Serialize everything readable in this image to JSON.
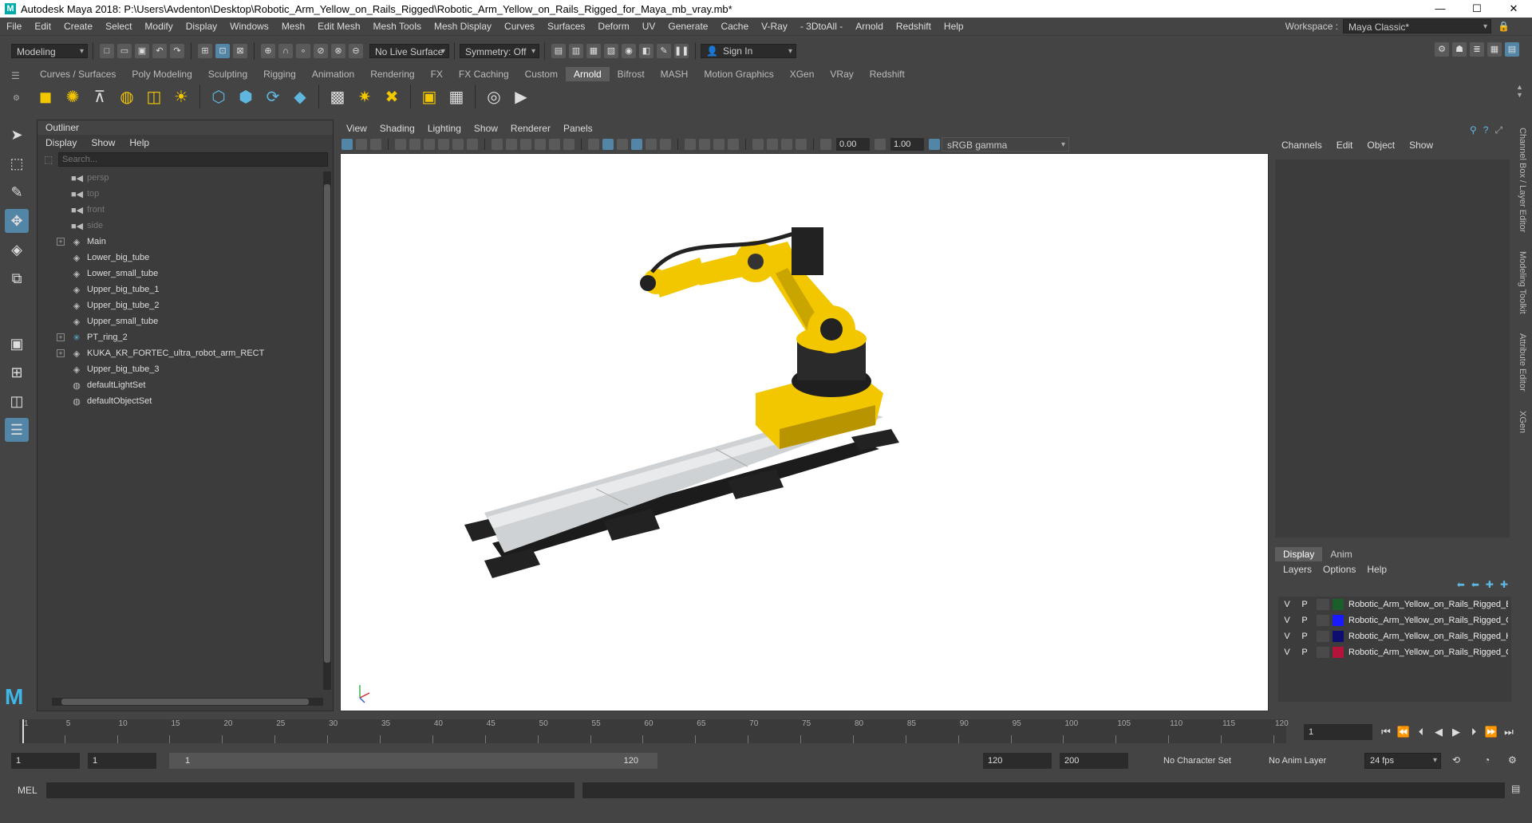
{
  "app": {
    "title": "Autodesk Maya 2018: P:\\Users\\Avdenton\\Desktop\\Robotic_Arm_Yellow_on_Rails_Rigged\\Robotic_Arm_Yellow_on_Rails_Rigged_for_Maya_mb_vray.mb*",
    "logo_letter": "M"
  },
  "window_controls": {
    "minimize": "—",
    "maximize": "☐",
    "close": "✕"
  },
  "menu": [
    "File",
    "Edit",
    "Create",
    "Select",
    "Modify",
    "Display",
    "Windows",
    "Mesh",
    "Edit Mesh",
    "Mesh Tools",
    "Mesh Display",
    "Curves",
    "Surfaces",
    "Deform",
    "UV",
    "Generate",
    "Cache",
    "V-Ray",
    "- 3DtoAll -",
    "Arnold",
    "Redshift",
    "Help"
  ],
  "workspace": {
    "label": "Workspace :",
    "value": "Maya Classic*"
  },
  "status_line": {
    "mode": "Modeling",
    "live_surface": "No Live Surface",
    "symmetry": "Symmetry: Off",
    "sign_in": "Sign In"
  },
  "shelf_tabs": [
    "Curves / Surfaces",
    "Poly Modeling",
    "Sculpting",
    "Rigging",
    "Animation",
    "Rendering",
    "FX",
    "FX Caching",
    "Custom",
    "Arnold",
    "Bifrost",
    "MASH",
    "Motion Graphics",
    "XGen",
    "VRay",
    "Redshift"
  ],
  "shelf_active": "Arnold",
  "outliner": {
    "title": "Outliner",
    "menus": [
      "Display",
      "Show",
      "Help"
    ],
    "search_placeholder": "Search...",
    "items": [
      {
        "label": "persp",
        "icon": "camera-icon",
        "dim": true,
        "expand": false
      },
      {
        "label": "top",
        "icon": "camera-icon",
        "dim": true,
        "expand": false
      },
      {
        "label": "front",
        "icon": "camera-icon",
        "dim": true,
        "expand": false
      },
      {
        "label": "side",
        "icon": "camera-icon",
        "dim": true,
        "expand": false
      },
      {
        "label": "Main",
        "icon": "transform-icon",
        "dim": false,
        "expand": true
      },
      {
        "label": "Lower_big_tube",
        "icon": "transform-icon",
        "dim": false,
        "expand": false
      },
      {
        "label": "Lower_small_tube",
        "icon": "transform-icon",
        "dim": false,
        "expand": false
      },
      {
        "label": "Upper_big_tube_1",
        "icon": "transform-icon",
        "dim": false,
        "expand": false
      },
      {
        "label": "Upper_big_tube_2",
        "icon": "transform-icon",
        "dim": false,
        "expand": false
      },
      {
        "label": "Upper_small_tube",
        "icon": "transform-icon",
        "dim": false,
        "expand": false
      },
      {
        "label": "PT_ring_2",
        "icon": "joint-icon",
        "dim": false,
        "expand": true
      },
      {
        "label": "KUKA_KR_FORTEC_ultra_robot_arm_RECT",
        "icon": "transform-icon",
        "dim": false,
        "expand": true
      },
      {
        "label": "Upper_big_tube_3",
        "icon": "transform-icon",
        "dim": false,
        "expand": false
      },
      {
        "label": "defaultLightSet",
        "icon": "set-icon",
        "dim": false,
        "expand": false
      },
      {
        "label": "defaultObjectSet",
        "icon": "set-icon",
        "dim": false,
        "expand": false
      }
    ]
  },
  "viewport": {
    "menus": [
      "View",
      "Shading",
      "Lighting",
      "Show",
      "Renderer",
      "Panels"
    ],
    "exposure": "0.00",
    "gamma": "1.00",
    "color_space": "sRGB gamma"
  },
  "channel_box": {
    "menus": [
      "Channels",
      "Edit",
      "Object",
      "Show"
    ]
  },
  "side_tabs": [
    "Channel Box / Layer Editor",
    "Modeling Toolkit",
    "Attribute Editor",
    "XGen"
  ],
  "layer_editor": {
    "tabs": [
      "Display",
      "Anim"
    ],
    "menus": [
      "Layers",
      "Options",
      "Help"
    ],
    "layers": [
      {
        "v": "V",
        "p": "P",
        "name": "Robotic_Arm_Yellow_on_Rails_Rigged_B",
        "color": "#1b5e2a"
      },
      {
        "v": "V",
        "p": "P",
        "name": "Robotic_Arm_Yellow_on_Rails_Rigged_C",
        "color": "#1a1aff"
      },
      {
        "v": "V",
        "p": "P",
        "name": "Robotic_Arm_Yellow_on_Rails_Rigged_H",
        "color": "#0e0e70"
      },
      {
        "v": "V",
        "p": "P",
        "name": "Robotic_Arm_Yellow_on_Rails_Rigged_C",
        "color": "#b3153a"
      }
    ]
  },
  "time_slider": {
    "ticks": [
      "1",
      "5",
      "10",
      "15",
      "20",
      "25",
      "30",
      "35",
      "40",
      "45",
      "50",
      "55",
      "60",
      "65",
      "70",
      "75",
      "80",
      "85",
      "90",
      "95",
      "100",
      "105",
      "110",
      "115",
      "120"
    ],
    "current_frame": "1"
  },
  "range_slider": {
    "start": "1",
    "anim_start": "1",
    "range_start": "1",
    "range_end": "120",
    "anim_end": "120",
    "end": "200",
    "character_set": "No Character Set",
    "anim_layer": "No Anim Layer",
    "fps": "24 fps"
  },
  "command_line": {
    "label": "MEL"
  },
  "colors": {
    "accent": "#5285a6",
    "panel": "#444444",
    "dark": "#2b2b2b",
    "robot_yellow": "#f2c700"
  }
}
